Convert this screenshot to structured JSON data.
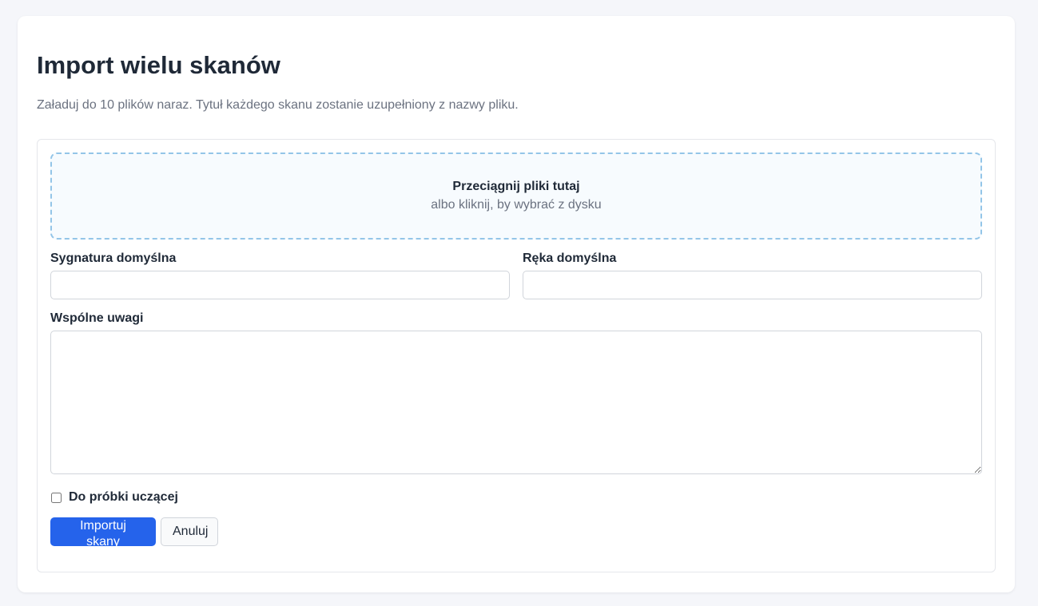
{
  "page": {
    "title": "Import wielu skanów",
    "subtitle": "Załaduj do 10 plików naraz. Tytuł każdego skanu zostanie uzupełniony z nazwy pliku."
  },
  "dropzone": {
    "title": "Przeciągnij pliki tutaj",
    "hint": "albo kliknij, by wybrać z dysku"
  },
  "fields": {
    "signature": {
      "label": "Sygnatura domyślna",
      "value": ""
    },
    "hand": {
      "label": "Ręka domyślna",
      "value": ""
    },
    "notes": {
      "label": "Wspólne uwagi",
      "value": ""
    }
  },
  "training_sample": {
    "label": "Do próbki uczącej",
    "checked": false
  },
  "actions": {
    "import_label": "Importuj skany",
    "cancel_label": "Anuluj"
  },
  "colors": {
    "primary": "#2563eb",
    "dropzone_border": "#93c5e8",
    "page_background": "#f5f6fa"
  }
}
